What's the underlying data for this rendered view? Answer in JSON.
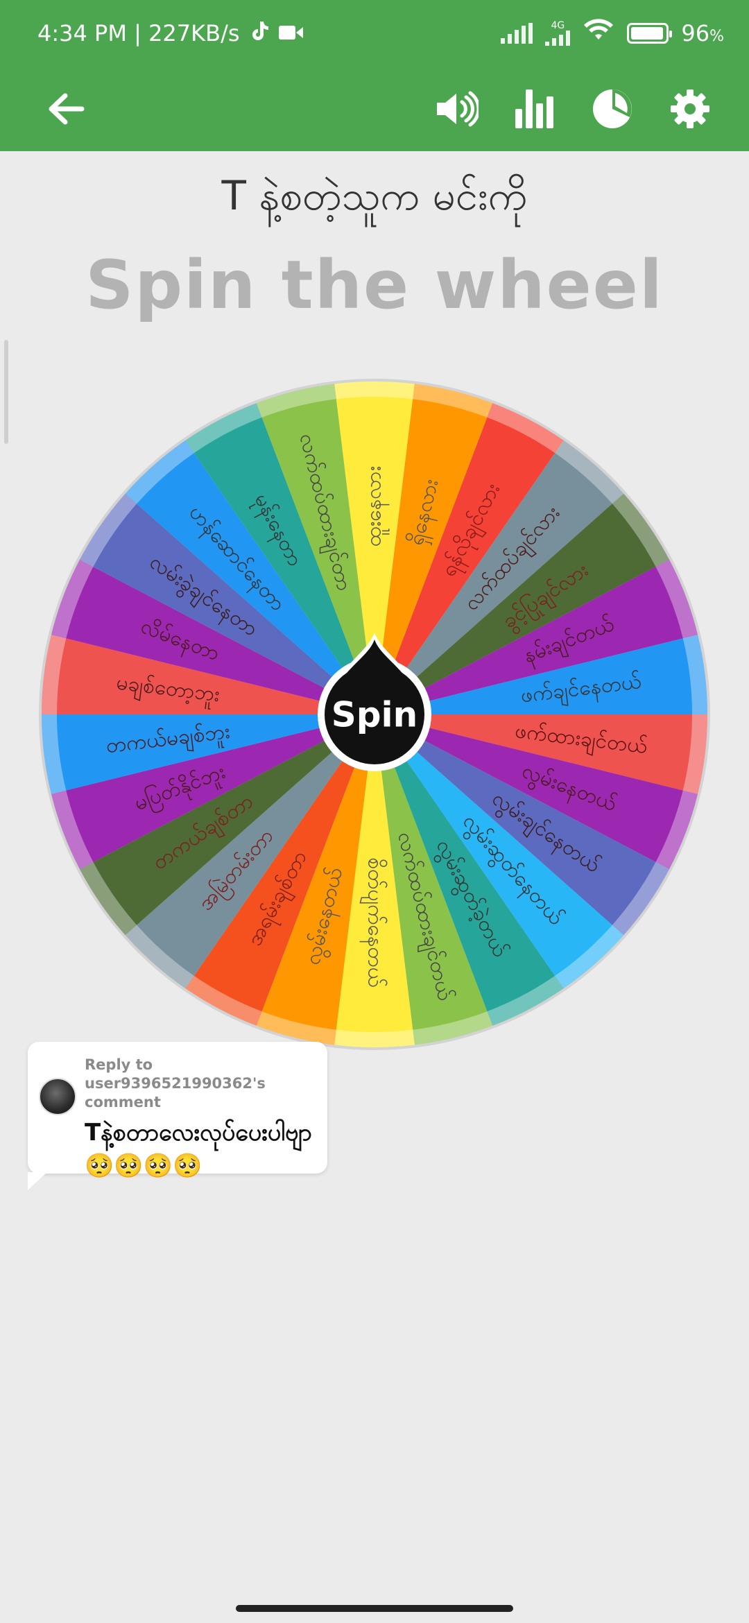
{
  "status_bar": {
    "time_speed": "4:34 PM | 227KB/s",
    "network": "4G",
    "battery": "96",
    "battery_unit": "%",
    "battery_level": 0.96
  },
  "toolbar": {
    "back_icon": "arrow-left-icon",
    "sound_icon": "speaker-icon",
    "stats_icon": "bar-chart-icon",
    "pie_icon": "pie-chart-icon",
    "settings_icon": "gear-icon"
  },
  "question": "T နဲ့စတဲ့သူက မင်းကို",
  "heading": "Spin the wheel",
  "wheel": {
    "button_label": "Spin",
    "segments": [
      {
        "label": "ထူးနေလား",
        "color": "#ffeb3b",
        "text_color": "#555555"
      },
      {
        "label": "ရှိနေလား",
        "color": "#ff9800",
        "text_color": "#555555"
      },
      {
        "label": "ရန်လိုချင်လား",
        "color": "#f44336",
        "text_color": "#8b1a1a"
      },
      {
        "label": "လက်ထပ်ချင်လား",
        "color": "#78909c",
        "text_color": "#4a1a1a"
      },
      {
        "label": "ခွင့်ပြုချင်လား",
        "color": "#4e6b35",
        "text_color": "#7c1f1f"
      },
      {
        "label": "နမ်းချင်တယ်",
        "color": "#9c27b0",
        "text_color": "#4a1a1a"
      },
      {
        "label": "ဖက်ချင်နေတယ်",
        "color": "#2196f3",
        "text_color": "#333333"
      },
      {
        "label": "ဖက်ထားချင်တယ်",
        "color": "#ef5350",
        "text_color": "#5a1010"
      },
      {
        "label": "လွမ်းနေတယ်",
        "color": "#9c27b0",
        "text_color": "#4a1a1a"
      },
      {
        "label": "လွမ်းချင်နေတယ်",
        "color": "#5c6bc0",
        "text_color": "#3a1a1a"
      },
      {
        "label": "လွမ်းဆွတ်နေတယ်",
        "color": "#29b6f6",
        "text_color": "#333333"
      },
      {
        "label": "လွမ်းဆွတ်ခဲ့တယ်",
        "color": "#26a69a",
        "text_color": "#333333"
      },
      {
        "label": "လက်ထပ်ထားချင်တယ်",
        "color": "#8bc34a",
        "text_color": "#444444"
      },
      {
        "label": "စိတ်ပျက်နေတယ်",
        "color": "#ffeb3b",
        "text_color": "#555555"
      },
      {
        "label": "လွမ်းနေတယ်",
        "color": "#ff9800",
        "text_color": "#555555"
      },
      {
        "label": "အရမ်းချစ်တာ",
        "color": "#f4511e",
        "text_color": "#7c1f1f"
      },
      {
        "label": "အမြဲတမ်းတာ",
        "color": "#78909c",
        "text_color": "#7c1f1f"
      },
      {
        "label": "တကယ်ချစ်တာ",
        "color": "#4e6b35",
        "text_color": "#7c1f1f"
      },
      {
        "label": "မပြတ်နိုင်ဘူး",
        "color": "#9c27b0",
        "text_color": "#4a1a1a"
      },
      {
        "label": "တကယ်မချစ်ဘူး",
        "color": "#2196f3",
        "text_color": "#4a1a1a"
      },
      {
        "label": "မချစ်တော့ဘူး",
        "color": "#ef5350",
        "text_color": "#4a1a1a"
      },
      {
        "label": "လိမ်နေတာ",
        "color": "#9c27b0",
        "text_color": "#4a1a1a"
      },
      {
        "label": "လမ်းခွဲချင်နေတာ",
        "color": "#5c6bc0",
        "text_color": "#3a1a1a"
      },
      {
        "label": "ဟန်ဆောင်နေတာ",
        "color": "#2196f3",
        "text_color": "#333333"
      },
      {
        "label": "မုန်းနေတာ",
        "color": "#26a69a",
        "text_color": "#333333"
      },
      {
        "label": "လက်ထပ်ထားချင်တာ",
        "color": "#8bc34a",
        "text_color": "#444444"
      }
    ]
  },
  "comment": {
    "reply_to": "Reply to user9396521990362's comment",
    "text": "Tနဲ့စတာလေးလုပ်ပေးပါဗျာ🥺🥺🥺🥺"
  }
}
